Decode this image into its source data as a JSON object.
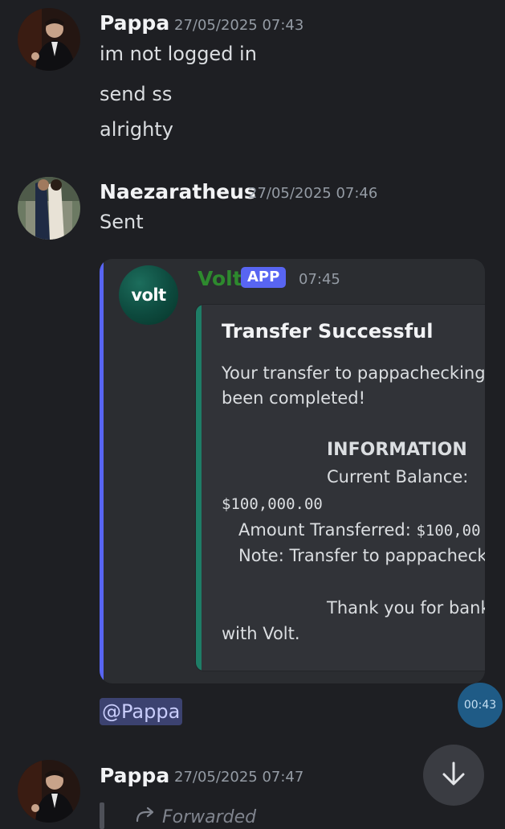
{
  "messages": [
    {
      "author": "Pappa",
      "timestamp": "27/05/2025 07:43",
      "lines": [
        "im not logged in",
        "send ss",
        "alrighty"
      ]
    },
    {
      "author": "Naezaratheus",
      "timestamp": "27/05/2025 07:46",
      "lines": [
        "Sent"
      ],
      "embed": {
        "bot_name": "Volt",
        "logo_text": "volt",
        "badge": "APP",
        "time": "07:45",
        "title": "Transfer Successful",
        "body_line_1": "Your transfer to pappachecking",
        "body_line_2": "been completed!",
        "info_heading": "INFORMATION",
        "balance_label": "Current Balance:",
        "balance_value": "$100,000.00",
        "amount_label": "Amount Transferred: ",
        "amount_value": "$100,00",
        "note": "Note: Transfer to pappacheck",
        "thanks_line_1": "Thank you for bank",
        "thanks_line_2": "with Volt."
      },
      "mention": "@Pappa"
    },
    {
      "author": "Pappa",
      "timestamp": "27/05/2025 07:47",
      "forwarded_label": "Forwarded"
    }
  ],
  "overlay": {
    "time_bubble": "00:43",
    "scroll_button_icon": "arrow-down-icon"
  },
  "colors": {
    "background": "#1e1f23",
    "embed_bar": "#5865f2",
    "inner_bar": "#1e7d66",
    "bot_name": "#2e8a2e",
    "mention_bg": "#3c4270"
  }
}
